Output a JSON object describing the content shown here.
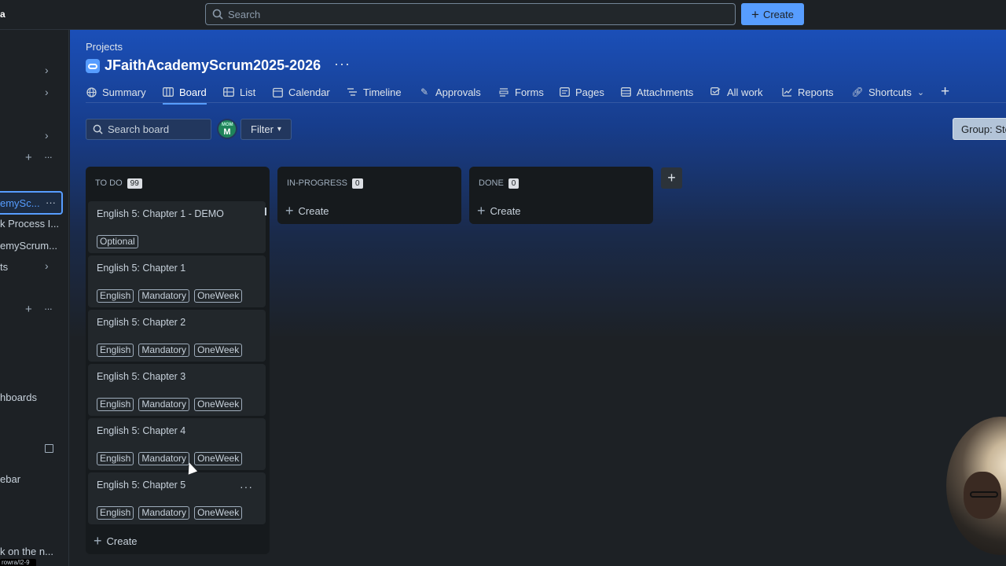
{
  "topbar": {
    "logo_fragment": "a",
    "search_placeholder": "Search",
    "create_label": "Create"
  },
  "sidebar": {
    "rows": [
      {
        "label": "emySc...",
        "active": true
      },
      {
        "label": "k Process I..."
      },
      {
        "label": "emyScrum..."
      },
      {
        "label": "ts"
      },
      {
        "label": "hboards"
      },
      {
        "label": "ebar"
      }
    ],
    "bottom_text": "k on the n...",
    "url_fragment": "rowra/l2-9"
  },
  "header": {
    "breadcrumb": "Projects",
    "title": "JFaithAcademyScrum2025-2026",
    "more": "···"
  },
  "tabs": [
    {
      "label": "Summary",
      "icon": "globe-icon"
    },
    {
      "label": "Board",
      "icon": "board-icon",
      "active": true
    },
    {
      "label": "List",
      "icon": "list-icon"
    },
    {
      "label": "Calendar",
      "icon": "calendar-icon"
    },
    {
      "label": "Timeline",
      "icon": "timeline-icon"
    },
    {
      "label": "Approvals",
      "icon": "approvals-icon"
    },
    {
      "label": "Forms",
      "icon": "forms-icon"
    },
    {
      "label": "Pages",
      "icon": "pages-icon"
    },
    {
      "label": "Attachments",
      "icon": "attachments-icon"
    },
    {
      "label": "All work",
      "icon": "all-work-icon"
    },
    {
      "label": "Reports",
      "icon": "reports-icon"
    },
    {
      "label": "Shortcuts",
      "icon": "link-icon"
    }
  ],
  "toolbar": {
    "search_board_placeholder": "Search board",
    "avatar_initial": "M",
    "avatar_mini": "MOM",
    "filter_label": "Filter",
    "group_by_label": "Group: Sto"
  },
  "columns": [
    {
      "name": "TO DO",
      "count": "99",
      "cards": [
        {
          "title": "English 5: Chapter 1 - DEMO",
          "labels": [
            "Optional"
          ]
        },
        {
          "title": "English 5: Chapter 1",
          "labels": [
            "English",
            "Mandatory",
            "OneWeek"
          ]
        },
        {
          "title": "English 5: Chapter 2",
          "labels": [
            "English",
            "Mandatory",
            "OneWeek"
          ]
        },
        {
          "title": "English 5: Chapter 3",
          "labels": [
            "English",
            "Mandatory",
            "OneWeek"
          ]
        },
        {
          "title": "English 5: Chapter 4",
          "labels": [
            "English",
            "Mandatory",
            "OneWeek"
          ]
        },
        {
          "title": "English 5: Chapter 5",
          "labels": [
            "English",
            "Mandatory",
            "OneWeek"
          ]
        }
      ],
      "create_label": "Create"
    },
    {
      "name": "IN-PROGRESS",
      "count": "0",
      "create_label": "Create"
    },
    {
      "name": "DONE",
      "count": "0",
      "create_label": "Create"
    }
  ],
  "colors": {
    "accent": "#579dff",
    "background": "#1d2125",
    "card": "#22272b"
  }
}
